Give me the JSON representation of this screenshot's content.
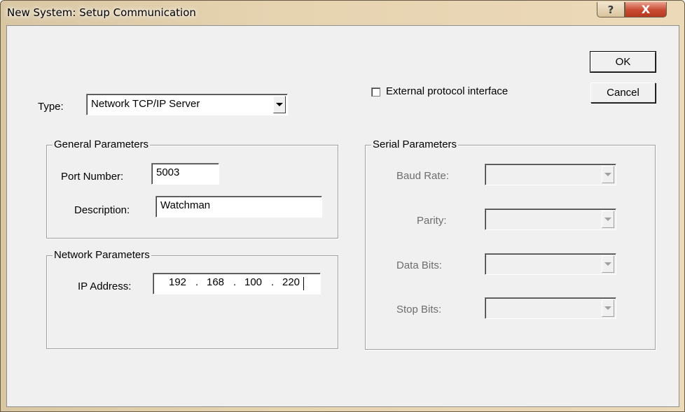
{
  "window": {
    "title": "New System: Setup Communication",
    "help_glyph": "?",
    "close_glyph": "X"
  },
  "buttons": {
    "ok": "OK",
    "cancel": "Cancel"
  },
  "type": {
    "label": "Type:",
    "selected": "Network TCP/IP Server"
  },
  "external_protocol": {
    "label": "External protocol interface",
    "checked": false
  },
  "general": {
    "title": "General Parameters",
    "port_label": "Port Number:",
    "port_value": "5003",
    "description_label": "Description:",
    "description_value": "Watchman"
  },
  "network": {
    "title": "Network Parameters",
    "ip_label": "IP Address:",
    "ip": [
      "192",
      "168",
      "100",
      "220"
    ],
    "dot": "."
  },
  "serial": {
    "title": "Serial Parameters",
    "baud_label": "Baud Rate:",
    "parity_label": "Parity:",
    "data_bits_label": "Data Bits:",
    "stop_bits_label": "Stop Bits:"
  },
  "colors": {
    "title_bar": "#e6d3b0",
    "dialog_bg": "#f0f0f0",
    "close_button": "#c84a30",
    "disabled_text": "#6d6d6d"
  }
}
